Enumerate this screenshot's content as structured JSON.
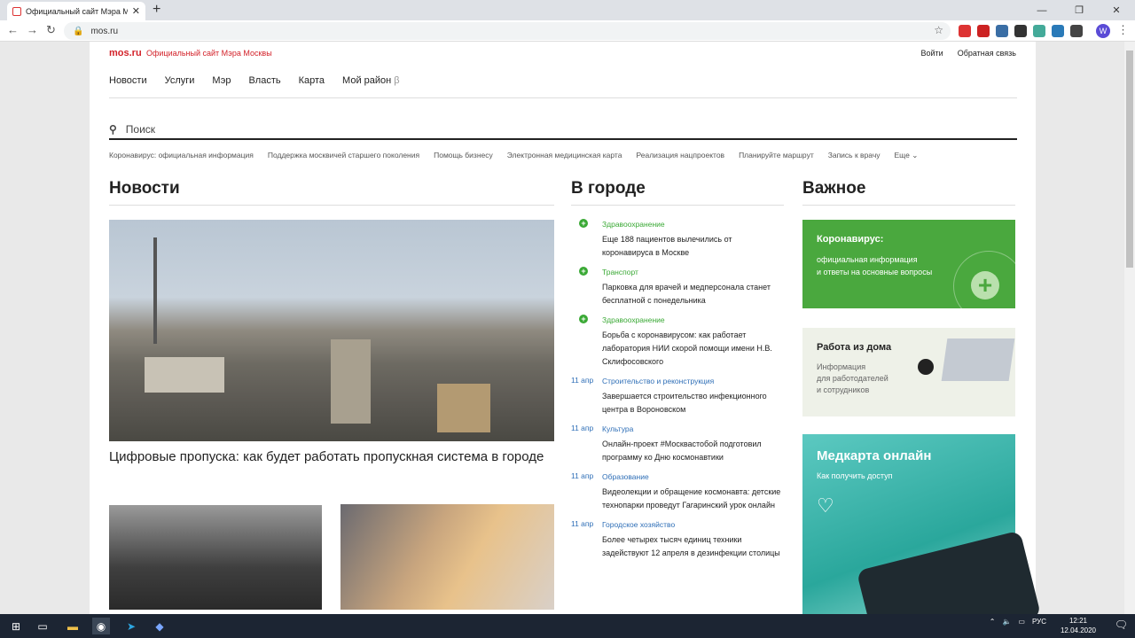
{
  "browser": {
    "tab_title": "Официальный сайт Мэра Моск",
    "url": "mos.ru",
    "avatar_letter": "W"
  },
  "site": {
    "logo": "mos.ru",
    "tagline": "Официальный сайт Мэра Москвы",
    "top_links": [
      "Войти",
      "Обратная связь"
    ],
    "nav": [
      "Новости",
      "Услуги",
      "Мэр",
      "Власть",
      "Карта",
      "Мой район"
    ],
    "nav_beta": "β",
    "search_placeholder": "Поиск",
    "quick_links": [
      "Коронавирус: официальная информация",
      "Поддержка москвичей старшего поколения",
      "Помощь бизнесу",
      "Электронная медицинская карта",
      "Реализация нацпроектов",
      "Планируйте маршрут",
      "Запись к врачу",
      "Еще"
    ]
  },
  "news": {
    "heading": "Новости",
    "hero_headline": "Цифровые пропуска: как будет работать пропускная система в городе"
  },
  "city": {
    "heading": "В городе",
    "items": [
      {
        "date": "",
        "category": "Здравоохранение",
        "text": "Еще 188 пациентов вылечились от коронавируса в Москве",
        "green": true
      },
      {
        "date": "",
        "category": "Транспорт",
        "text": "Парковка для врачей и медперсонала станет бесплатной с понедельника",
        "green": true
      },
      {
        "date": "",
        "category": "Здравоохранение",
        "text": "Борьба с коронавирусом: как работает лаборатория НИИ скорой помощи имени Н.В. Склифосовского",
        "green": true
      },
      {
        "date": "11 апр",
        "category": "Строительство и реконструкция",
        "text": "Завершается строительство инфекционного центра в Вороновском",
        "green": false
      },
      {
        "date": "11 апр",
        "category": "Культура",
        "text": "Онлайн-проект #Москвастобой подготовил программу ко Дню космонавтики",
        "green": false
      },
      {
        "date": "11 апр",
        "category": "Образование",
        "text": "Видеолекции и обращение космонавта: детские технопарки проведут Гагаринский урок онлайн",
        "green": false
      },
      {
        "date": "11 апр",
        "category": "Городское хозяйство",
        "text": "Более четырех тысяч единиц техники задействуют 12 апреля в дезинфекции столицы",
        "green": false
      }
    ]
  },
  "important": {
    "heading": "Важное",
    "card1_title": "Коронавирус:",
    "card1_text1": "официальная информация",
    "card1_text2": "и ответы на основные вопросы",
    "card2_title": "Работа из дома",
    "card2_text1": "Информация",
    "card2_text2": "для работодателей",
    "card2_text3": "и сотрудников",
    "card3_title": "Медкарта онлайн",
    "card3_text": "Как получить доступ"
  },
  "taskbar": {
    "lang": "РУС",
    "time": "12:21",
    "date": "12.04.2020",
    "notifications": "3"
  }
}
